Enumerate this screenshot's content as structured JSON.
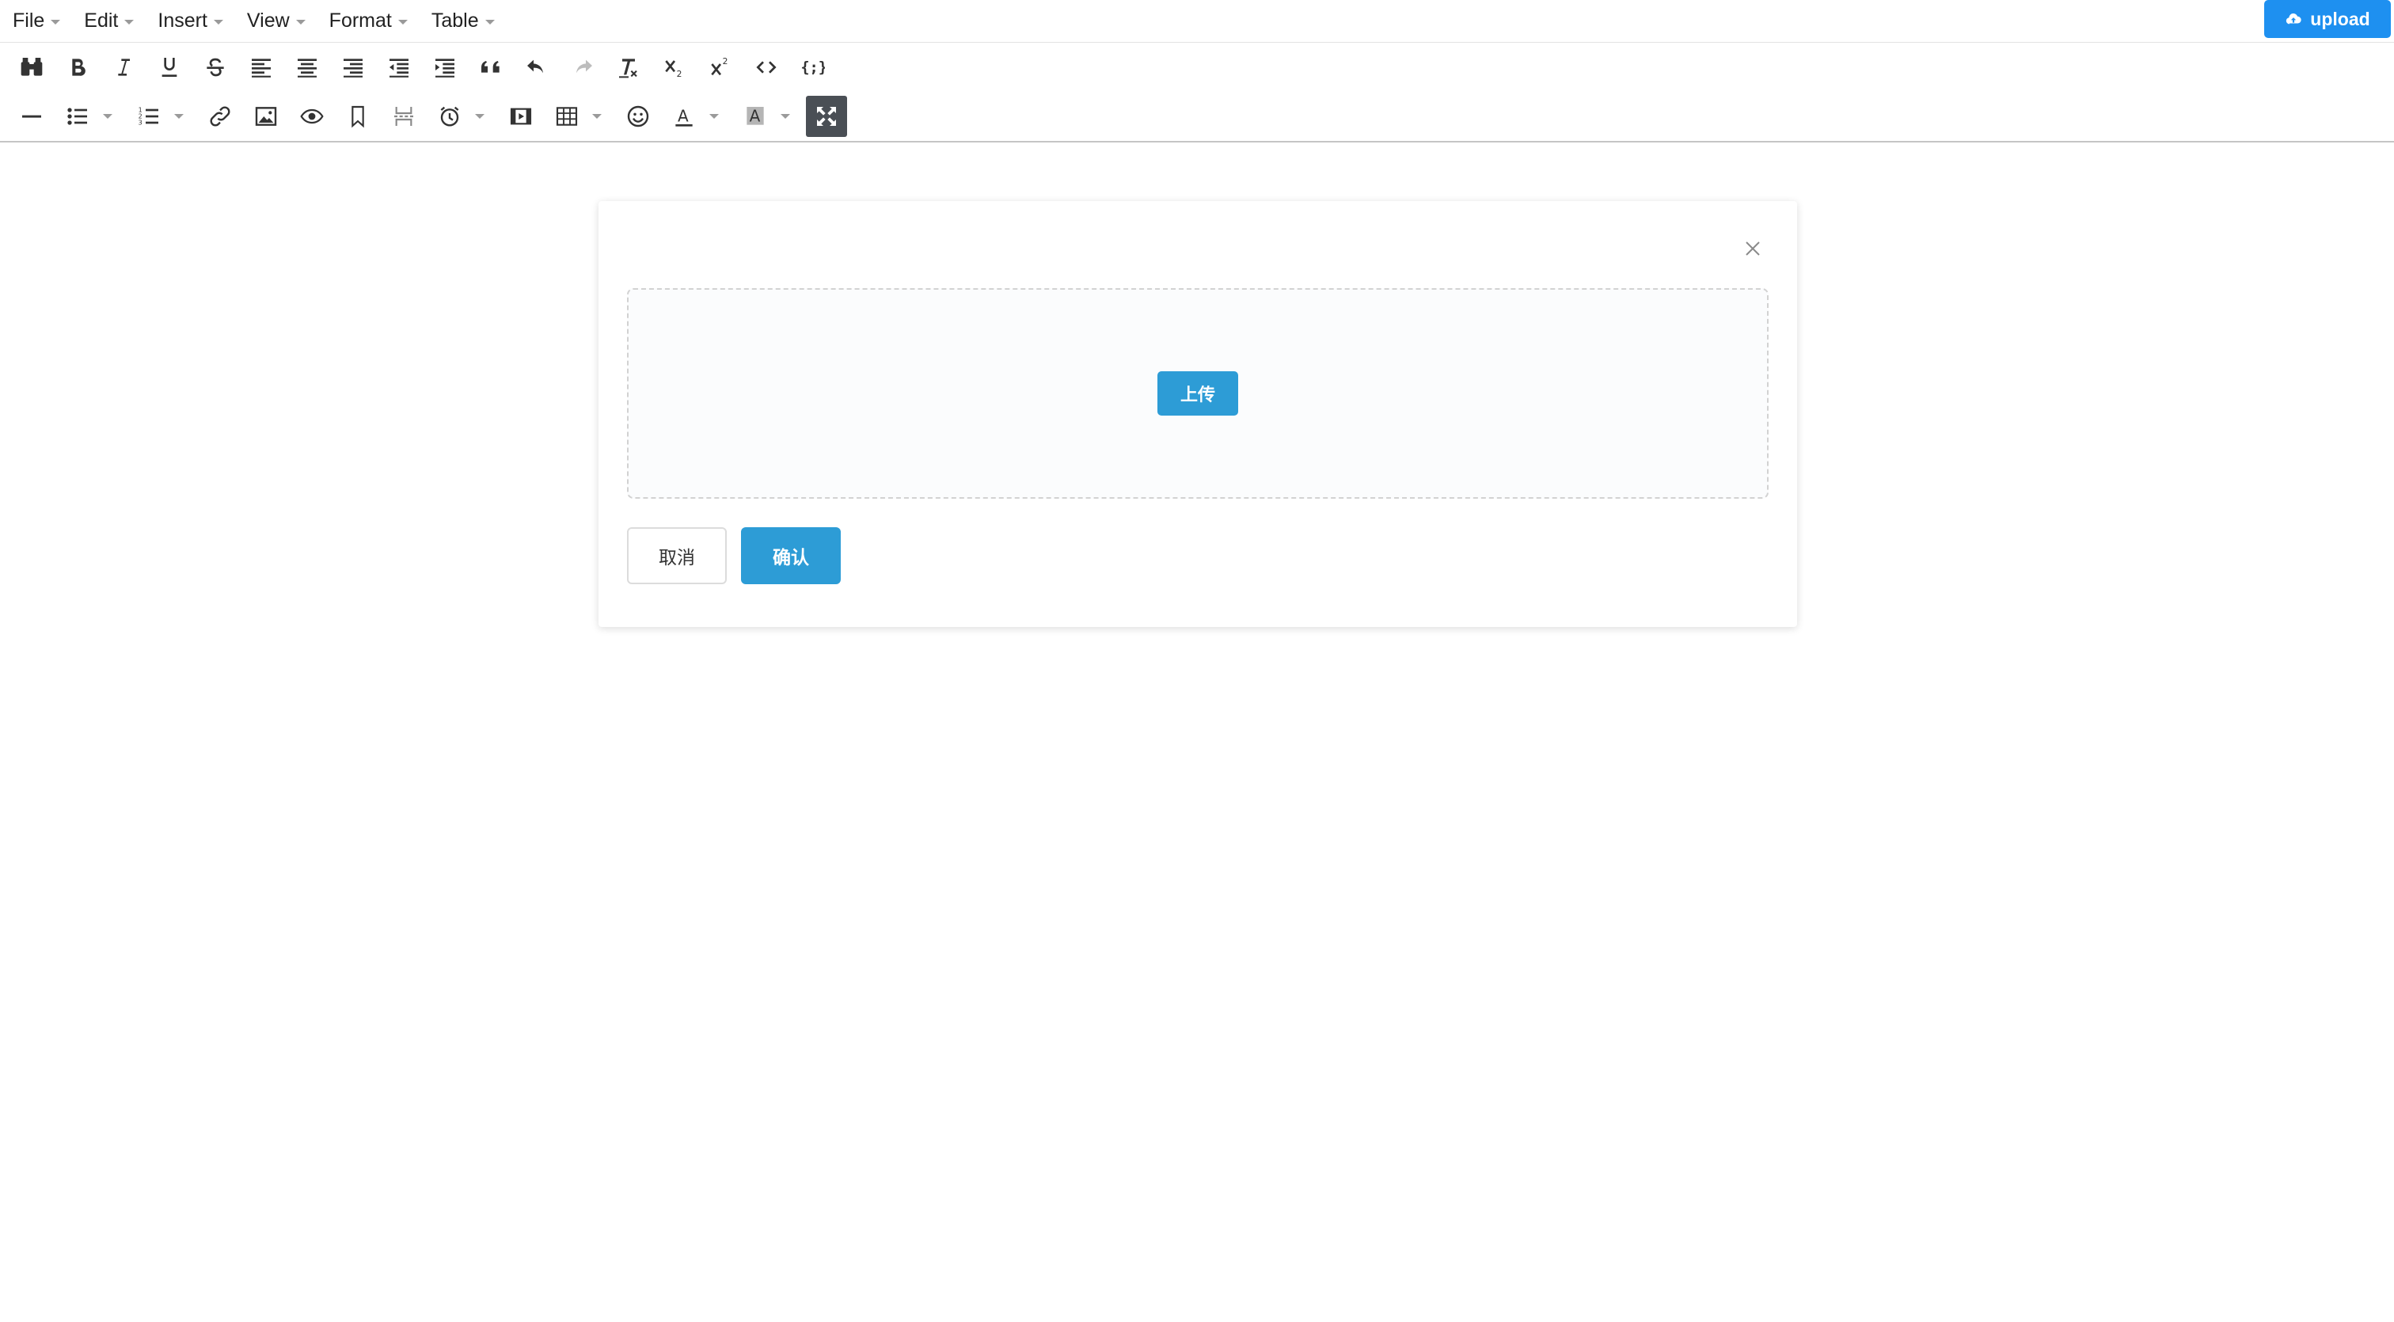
{
  "menubar": {
    "items": [
      {
        "label": "File"
      },
      {
        "label": "Edit"
      },
      {
        "label": "Insert"
      },
      {
        "label": "View"
      },
      {
        "label": "Format"
      },
      {
        "label": "Table"
      }
    ],
    "upload_button": {
      "label": "upload",
      "icon": "cloud-upload-icon",
      "color": "#1e90f0"
    }
  },
  "toolbar": {
    "row1": [
      "find-replace-icon",
      "bold-icon",
      "italic-icon",
      "underline-icon",
      "strikethrough-icon",
      "align-left-icon",
      "align-center-icon",
      "align-right-icon",
      "outdent-icon",
      "indent-icon",
      "blockquote-icon",
      "undo-icon",
      "redo-icon",
      "clear-format-icon",
      "subscript-icon",
      "superscript-icon",
      "code-icon",
      "template-icon"
    ],
    "row2": [
      "horizontal-rule-icon",
      "bullet-list-icon",
      "numbered-list-icon",
      "link-icon",
      "image-icon",
      "preview-icon",
      "bookmark-icon",
      "page-break-icon",
      "datetime-icon",
      "media-icon",
      "table-icon",
      "emoticon-icon",
      "text-color-icon",
      "background-color-icon",
      "fullscreen-icon"
    ],
    "text_color_letter": "A",
    "bg_color_letter": "A",
    "active_color": "#4a4f55"
  },
  "dialog": {
    "upload_label": "上传",
    "cancel_label": "取消",
    "confirm_label": "确认",
    "accent_color": "#2d9cd6"
  }
}
